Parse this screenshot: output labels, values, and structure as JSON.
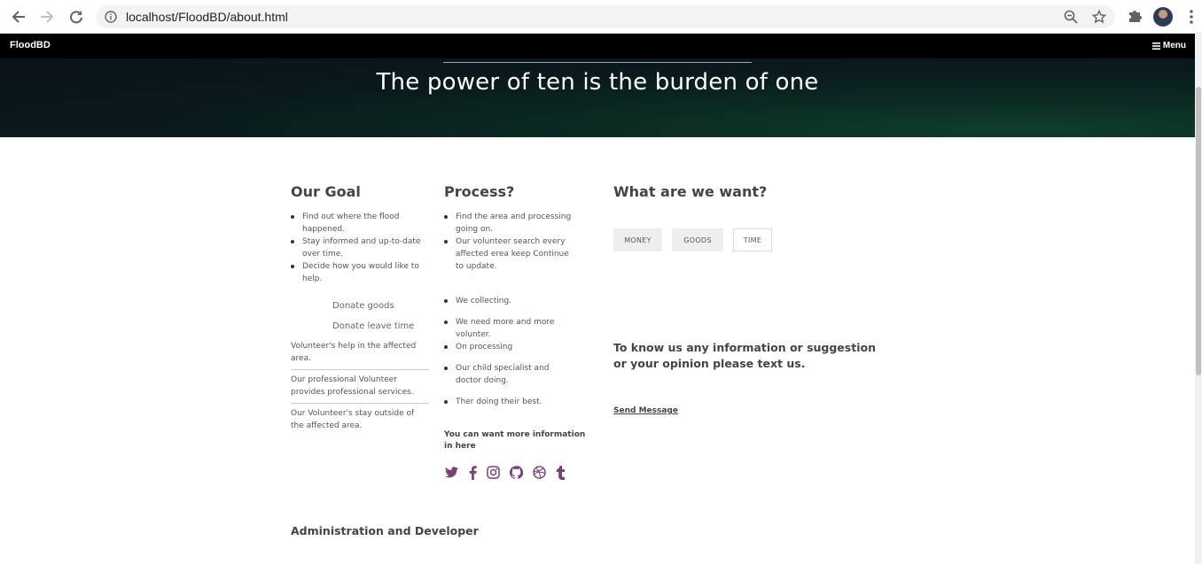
{
  "browser": {
    "url": "localhost/FloodBD/about.html"
  },
  "nav": {
    "brand": "FloodBD",
    "menu_label": "Menu"
  },
  "hero": {
    "title": "The power of ten is the burden of one"
  },
  "goal": {
    "heading": "Our Goal",
    "bullets": [
      "Find out where the flood happened.",
      "Stay informed and up-to-date over time.",
      "Decide how you would like to help."
    ],
    "donate_goods": "Donate goods",
    "donate_time": "Donate leave time",
    "paragraphs": [
      "Volunteer's help in the affected area.",
      "Our professional Volunteer provides professional services.",
      "Our Volunteer's stay outside of the affected area."
    ]
  },
  "process": {
    "heading": "Process?",
    "bullets_top": [
      "Find the area and processing going on.",
      "Our volunteer search every affected erea keep Continue to update."
    ],
    "bullets_bottom": [
      "We collecting.",
      "We need more and more volunter.",
      "On processing",
      "Our child specialist and doctor doing.",
      "Ther doing their best."
    ],
    "more_info": "You can want more information in here",
    "social_icons": [
      "twitter-icon",
      "facebook-icon",
      "instagram-icon",
      "github-icon",
      "dribbble-icon",
      "tumblr-icon"
    ]
  },
  "want": {
    "heading": "What are we want?",
    "tags": [
      "MONEY",
      "GOODS",
      "TIME"
    ],
    "contact_text": "To know us any information or suggestion or your opinion please text us.",
    "send_label": "Send Message"
  },
  "admin": {
    "heading": "Administration and Developer"
  },
  "colors": {
    "accent": "#7b3f78",
    "nav_bg": "#000000"
  }
}
